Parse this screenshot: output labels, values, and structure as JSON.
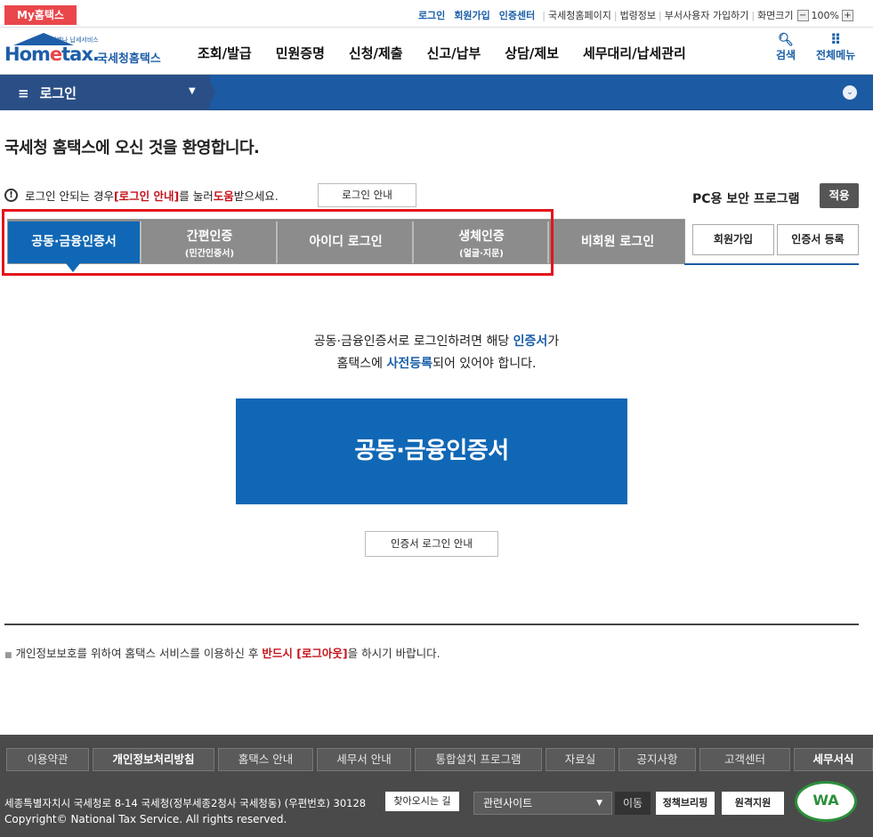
{
  "topbar": {
    "my_home": "My홈택스",
    "links": {
      "login": "로그인",
      "signup": "회원가입",
      "cert_center": "인증센터",
      "nts_page": "국세청홈페이지",
      "law_info": "법령정보",
      "dept_signup": "부서사용자 가입하기",
      "screen_size": "화면크기"
    },
    "zoom": "100%",
    "zoom_minus": "−",
    "zoom_plus": "+"
  },
  "header": {
    "logo_sub": "언제나 납세서비스",
    "logo_home_a": "Hom",
    "logo_home_b": "e",
    "logo_home_c": "tax.",
    "logo_nts": "국세청홈택스",
    "menu": [
      "조회/발급",
      "민원증명",
      "신청/제출",
      "신고/납부",
      "상담/제보",
      "세무대리/납세관리"
    ],
    "search_label": "검색",
    "all_menu_label": "전체메뉴",
    "search_icon_glyph": "🔍︎",
    "grid_icon_glyph": "⠿"
  },
  "navbar": {
    "menu_glyph": "≡",
    "title": "로그인",
    "dropdown_glyph": "▼",
    "circle_glyph": "⌄"
  },
  "main": {
    "welcome": "국세청 홈택스에 오신 것을 환영합니다.",
    "notice": {
      "prefix": "로그인 안되는 경우 ",
      "link": "[로그인 안내]",
      "mid": "를 눌러 ",
      "help": "도움",
      "suffix": "받으세요."
    },
    "guide_button": "로그인 안내",
    "pc_security": "PC용 보안 프로그램",
    "apply_button": "적용",
    "tabs": [
      {
        "label": "공동·금융인증서",
        "sub": ""
      },
      {
        "label": "간편인증",
        "sub": "(민간인증서)"
      },
      {
        "label": "아이디 로그인",
        "sub": ""
      },
      {
        "label": "생체인증",
        "sub": "(얼굴·지문)"
      },
      {
        "label": "비회원 로그인",
        "sub": ""
      }
    ],
    "signup_button": "회원가입",
    "cert_register_button": "인증서 등록",
    "msg": {
      "l1a": "공동·금융인증서로 로그인하려면 해당 ",
      "l1b": "인증서",
      "l1c": "가",
      "l2a": "홈택스에 ",
      "l2b": "사전등록",
      "l2c": "되어 있어야 합니다."
    },
    "big_button": "공동·금융인증서",
    "cert_guide_button": "인증서 로그인 안내",
    "privacy": {
      "prefix": "개인정보보호를 위하여 홈택스 서비스를 이용하신 후 ",
      "strong": "반드시 [로그아웃]",
      "suffix": "을 하시기 바랍니다."
    }
  },
  "footer": {
    "nav": [
      "이용약관",
      "개인정보처리방침",
      "홈택스 안내",
      "세무서 안내",
      "통합설치 프로그램",
      "자료실",
      "공지사항",
      "고객센터",
      "세무서식"
    ],
    "address": "세종특별자치시 국세청로 8-14 국세청(정부세종2청사 국세청동) (우편번호) 30128",
    "find_way": "찾아오시는 길",
    "copyright": "Copyright© National Tax Service. All rights reserved.",
    "related_sites": "관련사이트",
    "go": "이동",
    "policy_briefing": "정책브리핑",
    "remote_support": "원격지원",
    "wa_mark": "WA"
  }
}
